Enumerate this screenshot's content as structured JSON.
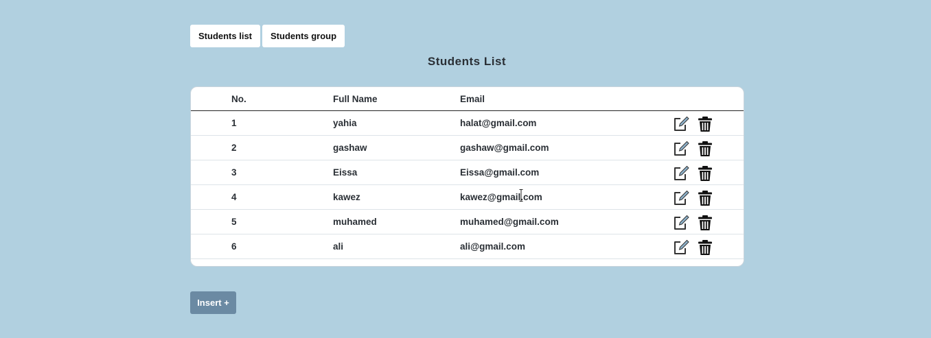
{
  "tabs": [
    {
      "label": "Students list"
    },
    {
      "label": "Students group"
    }
  ],
  "page_title": "Students List",
  "table": {
    "columns": {
      "no": "No.",
      "full_name": "Full Name",
      "email": "Email"
    },
    "rows": [
      {
        "no": "1",
        "name": "yahia",
        "email": "halat@gmail.com"
      },
      {
        "no": "2",
        "name": "gashaw",
        "email": "gashaw@gmail.com"
      },
      {
        "no": "3",
        "name": "Eissa",
        "email": "Eissa@gmail.com"
      },
      {
        "no": "4",
        "name": "kawez",
        "email": "kawez@gmail.com"
      },
      {
        "no": "5",
        "name": "muhamed",
        "email": "muhamed@gmail.com"
      },
      {
        "no": "6",
        "name": "ali",
        "email": "ali@gmail.com"
      }
    ],
    "row_action_icons": [
      "edit-icon",
      "trash-icon"
    ]
  },
  "insert_button": {
    "label": "Insert +"
  },
  "colors": {
    "page_background": "#b1d0e0",
    "insert_button": "#6b8aa3",
    "edit_icon_accent": "#8fb3cc"
  }
}
